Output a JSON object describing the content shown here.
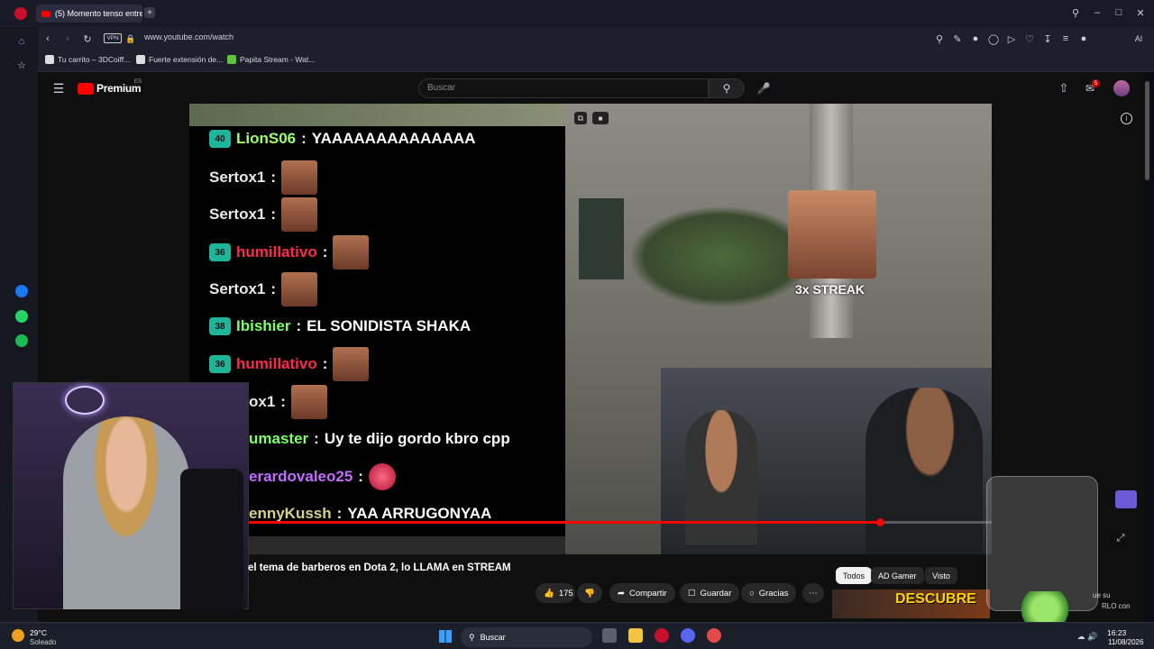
{
  "browser": {
    "tab_title": "(5) Momento tenso entre",
    "url": "www.youtube.com/watch",
    "vpn_label": "VPN",
    "ai_label": "AI",
    "bookmarks": [
      {
        "label": "Tu carrito – 3DCoiff..."
      },
      {
        "label": "Fuerte extensión de..."
      },
      {
        "label": "Papita Stream - Wat..."
      }
    ]
  },
  "youtube": {
    "logo_text": "Premium",
    "region": "ES",
    "search_placeholder": "Buscar",
    "notification_count": "5",
    "video_title": "el tema de barberos en Dota 2, lo LLAMA en STREAM",
    "progress_fraction": 0.85,
    "actions": {
      "likes": "175",
      "share": "Compartir",
      "save": "Guardar",
      "thanks": "Gracias"
    },
    "chips": [
      "Todos",
      "AD Gamer",
      "Visto"
    ],
    "streak_label": "3x STREAK",
    "recommended_thumb_text": "DESCUBRE",
    "side_text_1": "ue su",
    "side_text_2": "RLO con"
  },
  "chat": [
    {
      "badge": "40",
      "user": "LionS06",
      "msg": "YAAAAAAAAAAAAAA",
      "user_color": "#9dff6a"
    },
    {
      "badge": "",
      "user": "Sertox1",
      "msg": "",
      "user_color": "#e8e8e8"
    },
    {
      "badge": "",
      "user": "Sertox1",
      "msg": "",
      "user_color": "#e8e8e8"
    },
    {
      "badge": "36",
      "user": "humillativo",
      "msg": "",
      "user_color": "#ff2a4a"
    },
    {
      "badge": "",
      "user": "Sertox1",
      "msg": "",
      "user_color": "#e8e8e8"
    },
    {
      "badge": "38",
      "user": "Ibishier",
      "msg": "EL SONIDISTA SHAKA",
      "user_color": "#7dff6a"
    },
    {
      "badge": "36",
      "user": "humillativo",
      "msg": "",
      "user_color": "#ff2a4a"
    },
    {
      "badge": "",
      "user": "ox1",
      "msg": "",
      "user_color": "#e8e8e8"
    },
    {
      "badge": "",
      "user": "umaster",
      "msg": "Uy te dijo gordo kbro cpp",
      "user_color": "#7dff6a"
    },
    {
      "badge": "",
      "user": "erardovaleo25",
      "msg": "",
      "user_color": "#c36bff"
    },
    {
      "badge": "",
      "user": "ennyKussh",
      "msg": "YAA ARRUGONYAA",
      "user_color": "#d9d08a"
    }
  ],
  "taskbar": {
    "weather_temp": "29°C",
    "weather_desc": "Soleado",
    "search_label": "Buscar",
    "time": "16:23",
    "date": "11/08/2026"
  },
  "colors": {
    "accent_red": "#ff0000",
    "chat_badge": "#1fb59a"
  }
}
